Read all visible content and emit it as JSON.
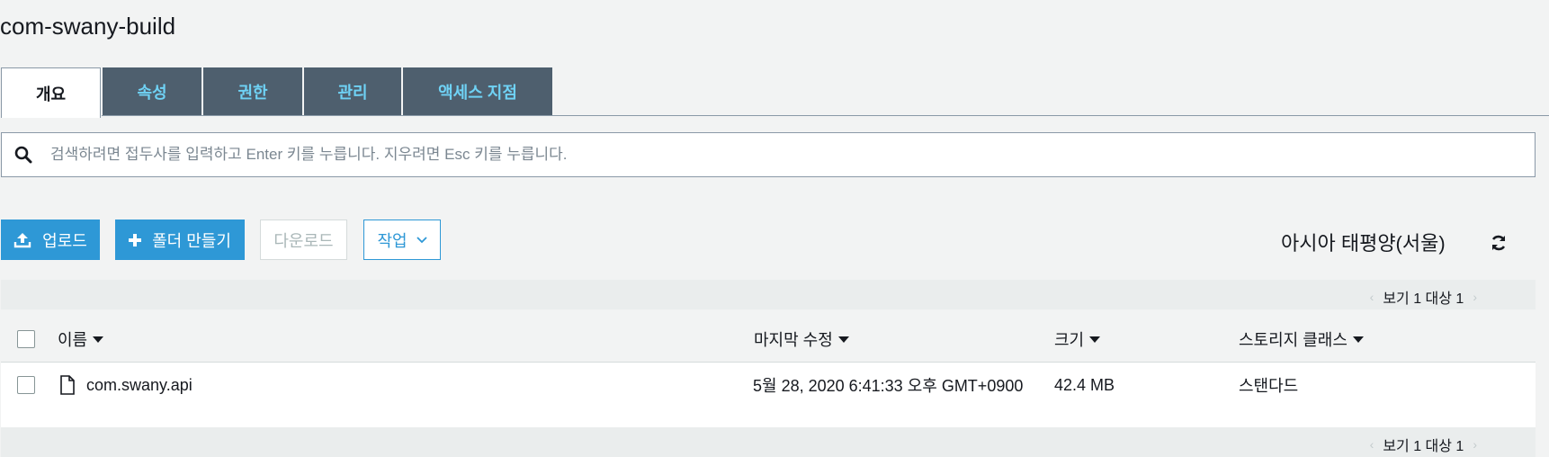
{
  "bucket": {
    "title": "com-swany-build"
  },
  "tabs": [
    {
      "label": "개요"
    },
    {
      "label": "속성"
    },
    {
      "label": "권한"
    },
    {
      "label": "관리"
    },
    {
      "label": "액세스 지점"
    }
  ],
  "search": {
    "placeholder": "검색하려면 접두사를 입력하고 Enter 키를 누릅니다. 지우려면 Esc 키를 누릅니다.",
    "value": ""
  },
  "toolbar": {
    "upload_label": "업로드",
    "create_folder_label": "폴더 만들기",
    "download_label": "다운로드",
    "actions_label": "작업",
    "region": "아시아 태평양(서울)",
    "refresh_icon": "refresh-icon"
  },
  "pagination": {
    "text": "보기 1 대상 1"
  },
  "table": {
    "columns": [
      "이름",
      "마지막 수정",
      "크기",
      "스토리지 클래스"
    ],
    "rows": [
      {
        "name": "com.swany.api",
        "modified": "5월 28, 2020 6:41:33 오후 GMT+0900",
        "size": "42.4 MB",
        "storage_class": "스탠다드"
      }
    ]
  },
  "colors": {
    "accent": "#2e98d6",
    "tab_bg": "#4e5f6e",
    "tab_text": "#6fd2f5"
  }
}
